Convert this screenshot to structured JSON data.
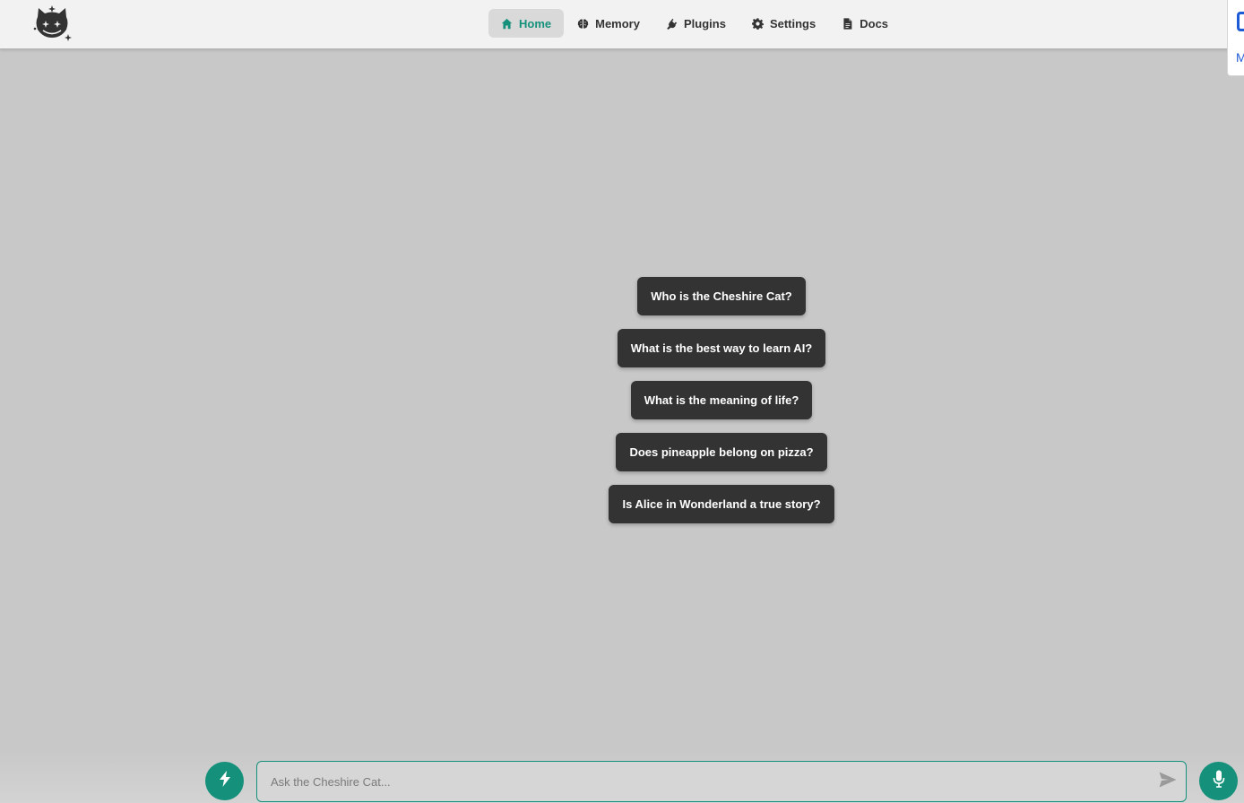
{
  "app": {
    "logo_icon": "cheshire-cat-logo-icon"
  },
  "nav": {
    "items": [
      {
        "label": "Home",
        "icon": "home-icon",
        "active": true
      },
      {
        "label": "Memory",
        "icon": "brain-icon",
        "active": false
      },
      {
        "label": "Plugins",
        "icon": "plug-icon",
        "active": false
      },
      {
        "label": "Settings",
        "icon": "gear-icon",
        "active": false
      },
      {
        "label": "Docs",
        "icon": "document-icon",
        "active": false
      }
    ]
  },
  "corner_panel": {
    "text": "M"
  },
  "suggestions": [
    "Who is the Cheshire Cat?",
    "What is the best way to learn AI?",
    "What is the meaning of life?",
    "Does pineapple belong on pizza?",
    "Is Alice in Wonderland a true story?"
  ],
  "chat": {
    "placeholder": "Ask the Cheshire Cat...",
    "value": "",
    "bolt_icon": "bolt-icon",
    "send_icon": "send-icon",
    "mic_icon": "microphone-icon"
  },
  "colors": {
    "accent": "#15917b",
    "suggestion_bg": "#333333",
    "page_bg": "#c8c8c8",
    "header_bg": "#f2f2f2"
  }
}
